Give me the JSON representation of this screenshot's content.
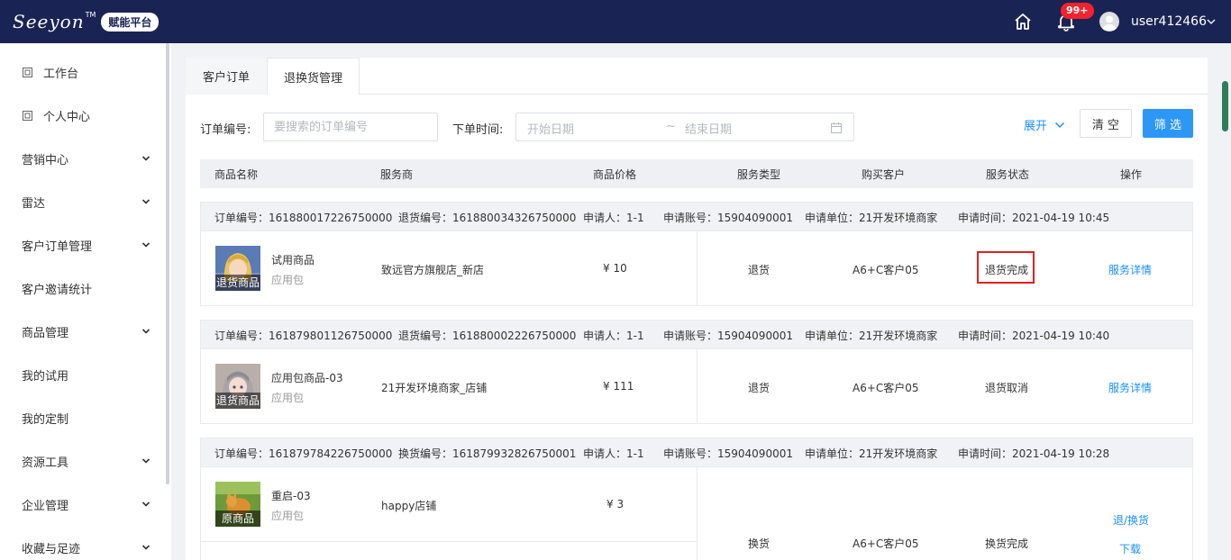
{
  "header": {
    "logo_text": "Seeyon",
    "logo_tm": "TM",
    "platform_badge": "赋能平台",
    "notification_count": "99+",
    "username": "user412466"
  },
  "sidebar": {
    "items": [
      {
        "label": "工作台",
        "icon": "workbench-icon",
        "expandable": false
      },
      {
        "label": "个人中心",
        "icon": "personal-icon",
        "expandable": false
      },
      {
        "label": "营销中心",
        "expandable": true
      },
      {
        "label": "雷达",
        "expandable": true
      },
      {
        "label": "客户订单管理",
        "expandable": true
      },
      {
        "label": "客户邀请统计",
        "expandable": false
      },
      {
        "label": "商品管理",
        "expandable": true
      },
      {
        "label": "我的试用",
        "expandable": false
      },
      {
        "label": "我的定制",
        "expandable": false
      },
      {
        "label": "资源工具",
        "expandable": true
      },
      {
        "label": "企业管理",
        "expandable": true
      },
      {
        "label": "收藏与足迹",
        "expandable": true
      }
    ]
  },
  "tabs": [
    {
      "label": "客户订单",
      "active": false
    },
    {
      "label": "退换货管理",
      "active": true
    }
  ],
  "filters": {
    "order_no_label": "订单编号:",
    "order_no_placeholder": "要搜索的订单编号",
    "order_time_label": "下单时间:",
    "start_placeholder": "开始日期",
    "range_sep": "~",
    "end_placeholder": "结束日期",
    "expand_label": "展开",
    "clear_label": "清 空",
    "filter_label": "筛 选"
  },
  "table": {
    "columns": [
      "商品名称",
      "服务商",
      "商品价格",
      "服务类型",
      "购买客户",
      "服务状态",
      "操作"
    ]
  },
  "orders": [
    {
      "order_no": "订单编号：161880017226750000",
      "service_no": "退货编号：161880034326750000",
      "applicant": "申请人：1-1",
      "account": "申请账号：15904090001",
      "unit": "申请单位：21开发环境商家",
      "time": "申请时间：2021-04-19 10:45",
      "product_name": "试用商品",
      "product_type": "应用包",
      "thumb_tag": "退货商品",
      "vendor": "致远官方旗舰店_新店",
      "price": "¥ 10",
      "service_type": "退货",
      "customer": "A6+C客户05",
      "status": "退货完成",
      "action": "服务详情"
    },
    {
      "order_no": "订单编号：161879801126750000",
      "service_no": "退货编号：161880002226750000",
      "applicant": "申请人：1-1",
      "account": "申请账号：15904090001",
      "unit": "申请单位：21开发环境商家",
      "time": "申请时间：2021-04-19 10:40",
      "product_name": "应用包商品-03",
      "product_type": "应用包",
      "thumb_tag": "退货商品",
      "vendor": "21开发环境商家_店铺",
      "price": "¥ 111",
      "service_type": "退货",
      "customer": "A6+C客户05",
      "status": "退货取消",
      "action": "服务详情"
    },
    {
      "order_no": "订单编号：161879784226750000",
      "service_no": "换货编号：161879932826750001",
      "applicant": "申请人：1-1",
      "account": "申请账号：15904090001",
      "unit": "申请单位：21开发环境商家",
      "time": "申请时间：2021-04-19 10:28",
      "product_name": "重启-03",
      "product_type": "应用包",
      "thumb_tag": "原商品",
      "vendor": "happy店铺",
      "price": "¥ 3",
      "service_type": "换货",
      "customer": "A6+C客户05",
      "status": "换货完成",
      "action": "退/换货",
      "action2": "下载"
    }
  ],
  "colors": {
    "header_bg": "#1a2454",
    "accent": "#1890ff",
    "primary_button": "#2d97f7",
    "highlight_border": "#e02020"
  }
}
